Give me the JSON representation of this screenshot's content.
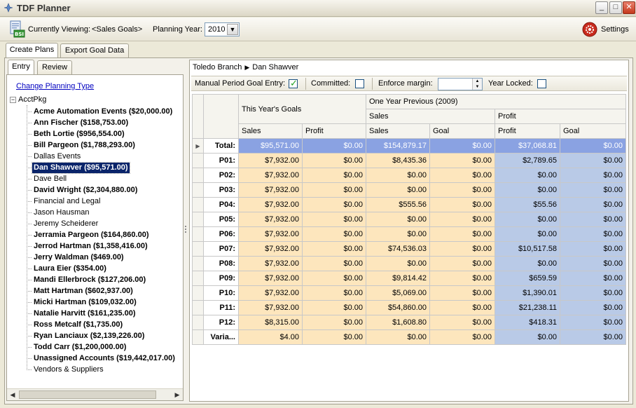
{
  "window": {
    "title": "TDF Planner",
    "minimize": "_",
    "maximize": "□",
    "close": "✕"
  },
  "toolbar": {
    "logo_text": "BSI",
    "viewing_label": "Currently Viewing:",
    "viewing_value": "<Sales Goals>",
    "year_label": "Planning Year:",
    "year_value": "2010",
    "settings_label": "Settings"
  },
  "outer_tabs": [
    {
      "label": "Create Plans",
      "active": true
    },
    {
      "label": "Export Goal Data",
      "active": false
    }
  ],
  "inner_tabs": [
    {
      "label": "Entry",
      "active": true
    },
    {
      "label": "Review",
      "active": false
    }
  ],
  "left": {
    "change_link": "Change Planning Type",
    "root_label": "AcctPkg",
    "items": [
      {
        "label": "Acme Automation Events ($20,000.00)",
        "bold": true
      },
      {
        "label": "Ann Fischer ($158,753.00)",
        "bold": true
      },
      {
        "label": "Beth Lortie ($956,554.00)",
        "bold": true
      },
      {
        "label": "Bill Pargeon ($1,788,293.00)",
        "bold": true
      },
      {
        "label": "Dallas Events",
        "bold": false
      },
      {
        "label": "Dan Shawver ($95,571.00)",
        "bold": true,
        "selected": true
      },
      {
        "label": "Dave Bell",
        "bold": false
      },
      {
        "label": "David Wright ($2,304,880.00)",
        "bold": true
      },
      {
        "label": "Financial and Legal",
        "bold": false
      },
      {
        "label": "Jason Hausman",
        "bold": false
      },
      {
        "label": "Jeremy Scheiderer",
        "bold": false
      },
      {
        "label": "Jerramia Pargeon ($164,860.00)",
        "bold": true
      },
      {
        "label": "Jerrod Hartman ($1,358,416.00)",
        "bold": true
      },
      {
        "label": "Jerry Waldman ($469.00)",
        "bold": true
      },
      {
        "label": "Laura Eier ($354.00)",
        "bold": true
      },
      {
        "label": "Mandi Ellerbrock ($127,206.00)",
        "bold": true
      },
      {
        "label": "Matt Hartman ($602,937.00)",
        "bold": true
      },
      {
        "label": "Micki Hartman ($109,032.00)",
        "bold": true
      },
      {
        "label": "Natalie Harvitt ($161,235.00)",
        "bold": true
      },
      {
        "label": "Ross Metcalf ($1,735.00)",
        "bold": true
      },
      {
        "label": "Ryan Lanciaux ($2,139,226.00)",
        "bold": true
      },
      {
        "label": "Todd Carr ($1,200,000.00)",
        "bold": true
      },
      {
        "label": "Unassigned Accounts ($19,442,017.00)",
        "bold": true
      },
      {
        "label": "Vendors & Suppliers",
        "bold": false
      }
    ]
  },
  "right": {
    "breadcrumb": [
      "Toledo Branch",
      "Dan Shawver"
    ],
    "options": {
      "manual_label": "Manual Period Goal Entry:",
      "manual_checked": true,
      "committed_label": "Committed:",
      "committed_checked": false,
      "margin_label": "Enforce margin:",
      "margin_value": "",
      "locked_label": "Year Locked:",
      "locked_checked": false
    },
    "grid": {
      "group_this_year": "This Year's Goals",
      "group_prev_year": "One Year Previous (2009)",
      "subgroup_sales": "Sales",
      "subgroup_profit": "Profit",
      "columns": [
        "Sales",
        "Profit",
        "Sales",
        "Goal",
        "Profit",
        "Goal"
      ],
      "rows": [
        {
          "label": "Total:",
          "total": true,
          "values": [
            "$95,571.00",
            "$0.00",
            "$154,879.17",
            "$0.00",
            "$37,068.81",
            "$0.00"
          ]
        },
        {
          "label": "P01:",
          "values": [
            "$7,932.00",
            "$0.00",
            "$8,435.36",
            "$0.00",
            "$2,789.65",
            "$0.00"
          ]
        },
        {
          "label": "P02:",
          "values": [
            "$7,932.00",
            "$0.00",
            "$0.00",
            "$0.00",
            "$0.00",
            "$0.00"
          ]
        },
        {
          "label": "P03:",
          "values": [
            "$7,932.00",
            "$0.00",
            "$0.00",
            "$0.00",
            "$0.00",
            "$0.00"
          ]
        },
        {
          "label": "P04:",
          "values": [
            "$7,932.00",
            "$0.00",
            "$555.56",
            "$0.00",
            "$55.56",
            "$0.00"
          ]
        },
        {
          "label": "P05:",
          "values": [
            "$7,932.00",
            "$0.00",
            "$0.00",
            "$0.00",
            "$0.00",
            "$0.00"
          ]
        },
        {
          "label": "P06:",
          "values": [
            "$7,932.00",
            "$0.00",
            "$0.00",
            "$0.00",
            "$0.00",
            "$0.00"
          ]
        },
        {
          "label": "P07:",
          "values": [
            "$7,932.00",
            "$0.00",
            "$74,536.03",
            "$0.00",
            "$10,517.58",
            "$0.00"
          ]
        },
        {
          "label": "P08:",
          "values": [
            "$7,932.00",
            "$0.00",
            "$0.00",
            "$0.00",
            "$0.00",
            "$0.00"
          ]
        },
        {
          "label": "P09:",
          "values": [
            "$7,932.00",
            "$0.00",
            "$9,814.42",
            "$0.00",
            "$659.59",
            "$0.00"
          ]
        },
        {
          "label": "P10:",
          "values": [
            "$7,932.00",
            "$0.00",
            "$5,069.00",
            "$0.00",
            "$1,390.01",
            "$0.00"
          ]
        },
        {
          "label": "P11:",
          "values": [
            "$7,932.00",
            "$0.00",
            "$54,860.00",
            "$0.00",
            "$21,238.11",
            "$0.00"
          ]
        },
        {
          "label": "P12:",
          "values": [
            "$8,315.00",
            "$0.00",
            "$1,608.80",
            "$0.00",
            "$418.31",
            "$0.00"
          ]
        },
        {
          "label": "Varia...",
          "values": [
            "$4.00",
            "$0.00",
            "$0.00",
            "$0.00",
            "$0.00",
            "$0.00"
          ]
        }
      ]
    }
  }
}
